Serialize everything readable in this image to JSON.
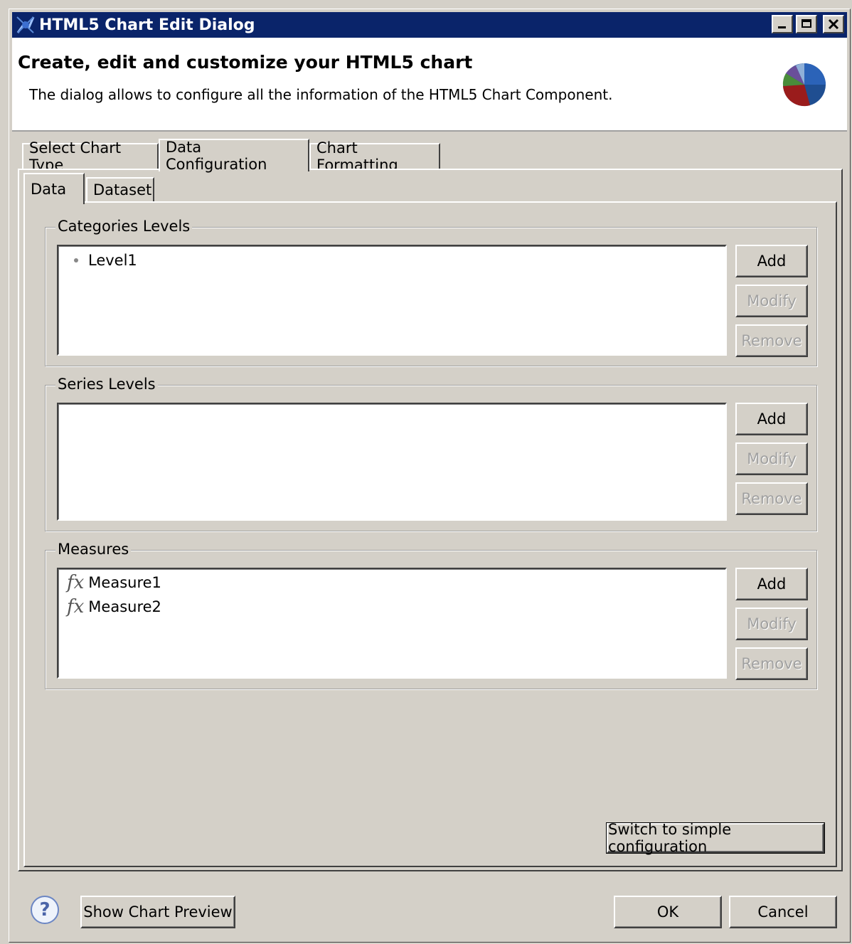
{
  "window": {
    "title": "HTML5 Chart Edit Dialog",
    "icons": {
      "app": "html5-chart-app-icon",
      "minimize": "minimize-icon",
      "maximize": "maximize-icon",
      "close": "close-icon"
    }
  },
  "banner": {
    "heading": "Create, edit and customize your HTML5 chart",
    "description": "The dialog allows to configure all the information of the HTML5 Chart Component.",
    "icon": "pie-chart-icon"
  },
  "tabs": [
    "Select Chart Type",
    "Data Configuration",
    "Chart Formatting"
  ],
  "active_tab": "Data Configuration",
  "subtabs": [
    "Data",
    "Dataset"
  ],
  "active_subtab": "Data",
  "groups": {
    "categories": {
      "label": "Categories Levels",
      "items": [
        "Level1"
      ],
      "buttons": {
        "add": "Add",
        "modify": "Modify",
        "remove": "Remove"
      }
    },
    "series": {
      "label": "Series Levels",
      "items": [],
      "buttons": {
        "add": "Add",
        "modify": "Modify",
        "remove": "Remove"
      }
    },
    "measures": {
      "label": "Measures",
      "item_icon": "fx",
      "items": [
        "Measure1",
        "Measure2"
      ],
      "buttons": {
        "add": "Add",
        "modify": "Modify",
        "remove": "Remove"
      }
    }
  },
  "switch_button": "Switch to simple configuration",
  "footer": {
    "help_icon": "help-icon",
    "help_glyph": "?",
    "show_preview": "Show Chart Preview",
    "ok": "OK",
    "cancel": "Cancel"
  },
  "colors": {
    "titlebar": "#0a246a",
    "face": "#d4d0c8"
  }
}
